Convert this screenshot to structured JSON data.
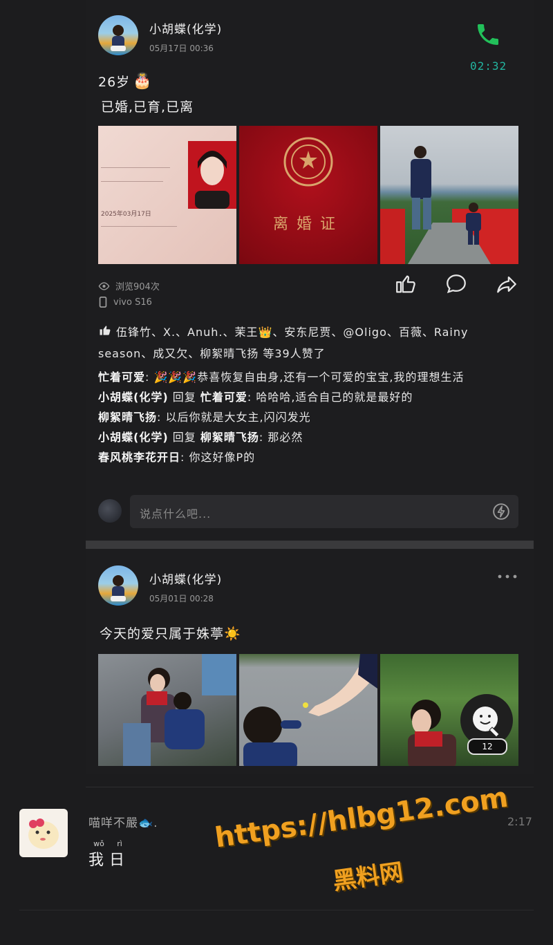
{
  "post1": {
    "user_name": "小胡蝶(化学)",
    "time": "05月17日 00:36",
    "call_duration": "02:32",
    "text_line1": "26岁",
    "text_line2": "已婚,已育,已离",
    "photo2_text": "离婚证",
    "certificate_date": "2025年03月17日",
    "views": "浏览904次",
    "device": "vivo S16",
    "likes_text": "伍锋竹、X.、Anuh.、茉王👑、安东尼贾、@Oligo、百薇、Rainy season、成又欠、柳絮晴飞扬 等39人赞了",
    "comments": [
      {
        "name": "忙着可爱",
        "reply_to": "",
        "text": "🎉🎉🎉恭喜恢复自由身,还有一个可爱的宝宝,我的理想生活"
      },
      {
        "name": "小胡蝶(化学)",
        "reply_to": "忙着可爱",
        "text": "哈哈哈,适合自己的就是最好的"
      },
      {
        "name": "柳絮晴飞扬",
        "reply_to": "",
        "text": "以后你就是大女主,闪闪发光"
      },
      {
        "name": "小胡蝶(化学)",
        "reply_to": "柳絮晴飞扬",
        "text": "那必然"
      },
      {
        "name": "春风桃李花开日",
        "reply_to": "",
        "text": "你这好像P的"
      }
    ],
    "reply_word": "回复",
    "comment_placeholder": "说点什么吧..."
  },
  "post2": {
    "user_name": "小胡蝶(化学)",
    "time": "05月01日 00:28",
    "text": "今天的爱只属于姝葶☀️",
    "float_badge": "12"
  },
  "chat": {
    "sender": "喵咩不嚴🐟.",
    "time_partial": "2:17",
    "pinyin1": "wǒ",
    "pinyin2": "rì",
    "message": "我日"
  },
  "watermark": {
    "url": "https://hlbg12.com",
    "site": "黑料网"
  }
}
